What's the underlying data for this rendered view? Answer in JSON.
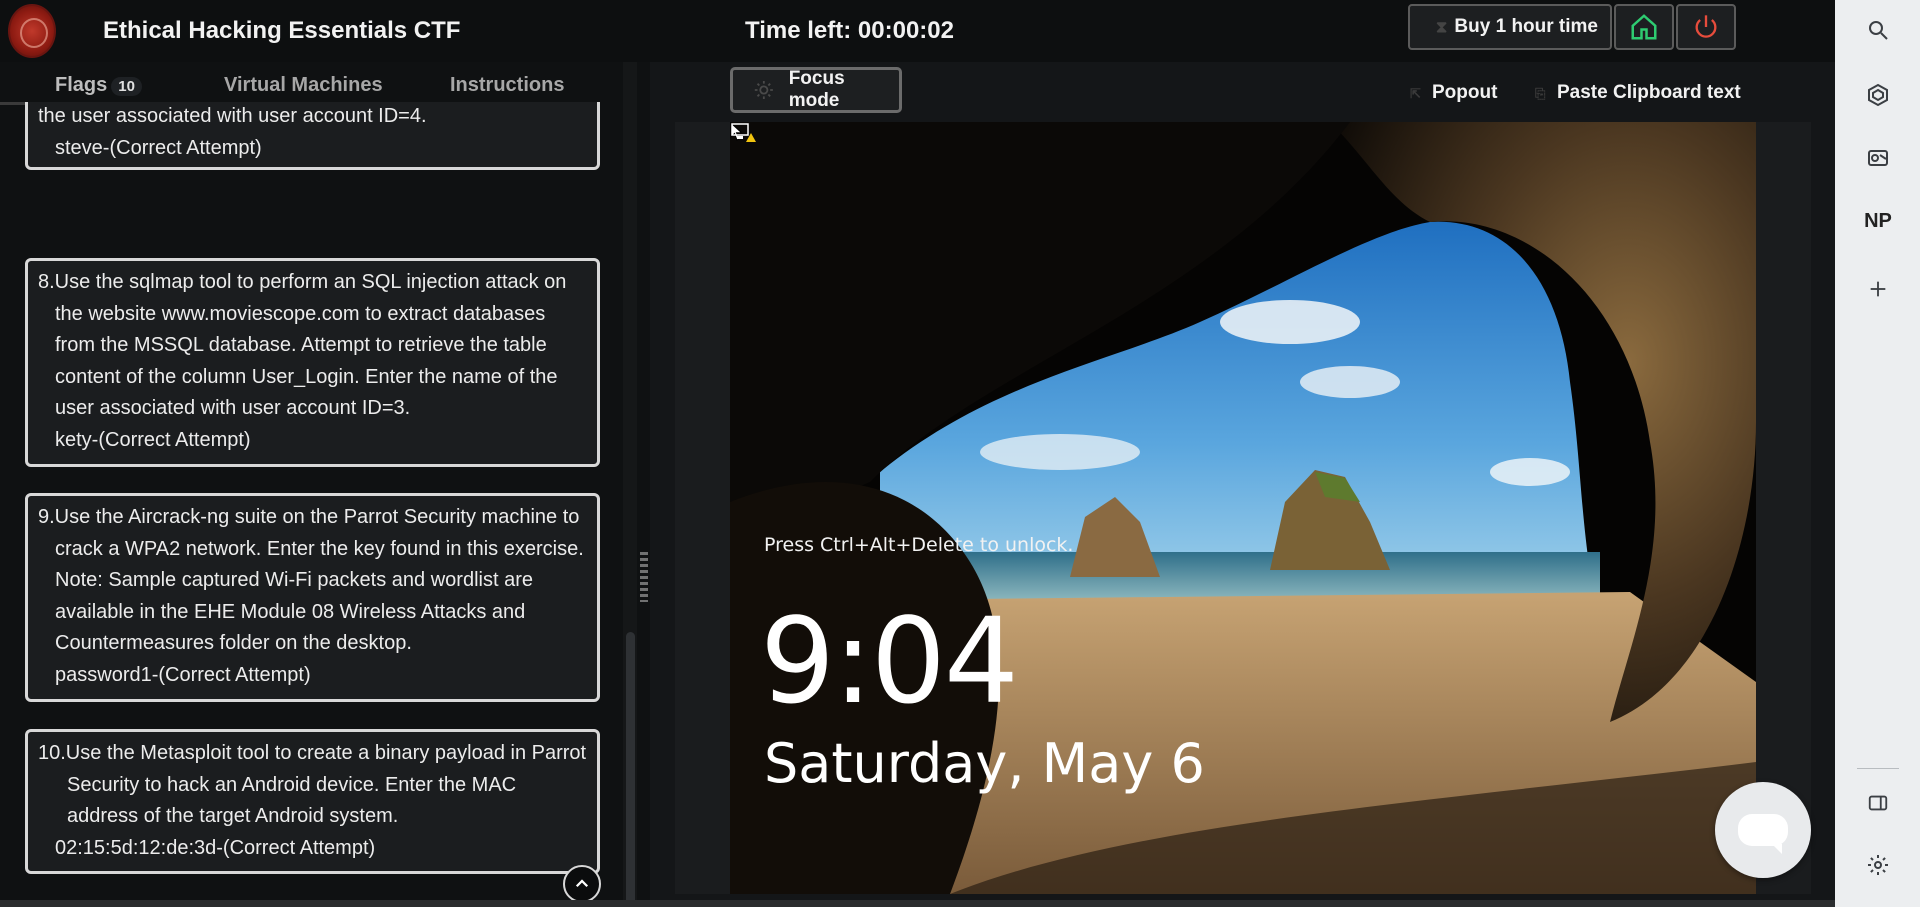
{
  "header": {
    "title": "Ethical Hacking Essentials CTF",
    "timer": "Time left: 00:00:02",
    "buy_label": "Buy 1 hour time"
  },
  "tabs": {
    "flags": "Flags",
    "flags_count": "10",
    "vms": "Virtual Machines",
    "instructions": "Instructions"
  },
  "questions": [
    {
      "text": "the user associated with user account ID=4.",
      "answer": "steve-(Correct Attempt)"
    },
    {
      "text": "8.Use the sqlmap tool to perform an SQL injection attack on the website www.moviescope.com to extract databases from the MSSQL database. Attempt to retrieve the table content of the column User_Login. Enter the name of the user associated with user account ID=3.",
      "answer": "kety-(Correct Attempt)"
    },
    {
      "text": "9.Use the Aircrack-ng suite on the Parrot Security machine to crack a WPA2 network. Enter the key found in this exercise. Note: Sample captured Wi-Fi packets and wordlist are available in the EHE Module 08 Wireless Attacks and Countermeasures folder on the desktop.",
      "answer": "password1-(Correct Attempt)"
    },
    {
      "text": "10.Use the Metasploit tool to create a binary payload in Parrot Security to hack an Android device. Enter the MAC address of the target Android system.",
      "answer": "02:15:5d:12:de:3d-(Correct Attempt)"
    }
  ],
  "toolbar": {
    "focus_mode": "Focus mode",
    "popout": "Popout",
    "paste": "Paste Clipboard text"
  },
  "lockscreen": {
    "hint": "Press Ctrl+Alt+Delete to unlock.",
    "time": "9:04",
    "date": "Saturday, May 6"
  },
  "sidebar_right": {
    "icons": [
      "search-icon",
      "copilot-icon",
      "outlook-icon",
      "np-icon",
      "add-icon",
      "sidebar-toggle-icon",
      "settings-icon"
    ],
    "np_label": "NP"
  },
  "colors": {
    "home_green": "#2ecc71",
    "power_red": "#e74c3c",
    "card_border": "#d8d8d8"
  }
}
